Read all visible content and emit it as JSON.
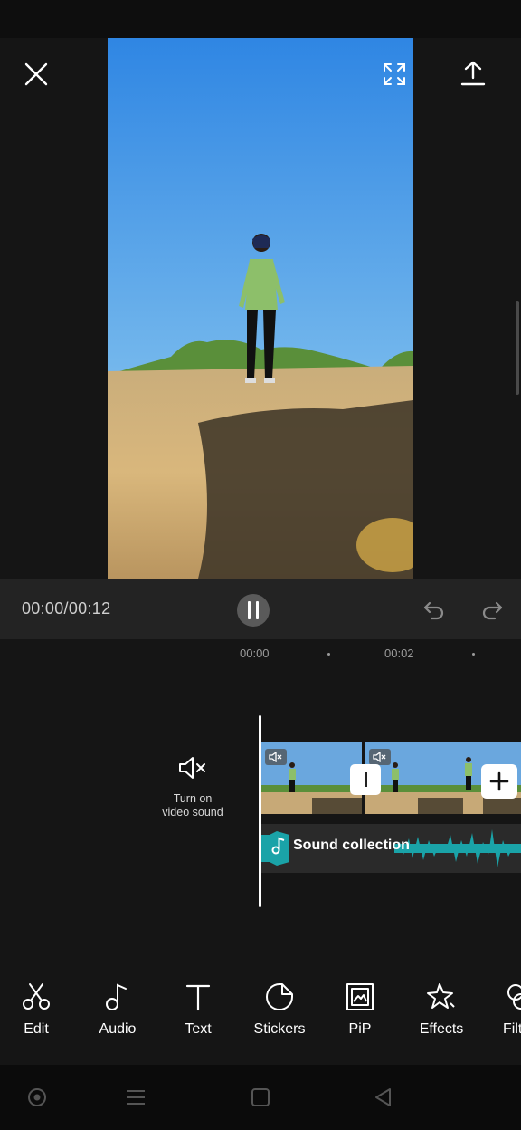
{
  "header": {
    "close_icon": "close-icon",
    "fullscreen_icon": "fullscreen-icon",
    "export_icon": "export-upload-icon"
  },
  "player": {
    "timecode": "00:00/00:12",
    "state": "playing",
    "pause_icon": "pause-icon",
    "undo_icon": "undo-icon",
    "redo_icon": "redo-icon"
  },
  "timeline": {
    "ruler": [
      "00:00",
      "00:02"
    ],
    "mute_control": {
      "icon": "speaker-muted-icon",
      "label_line1": "Turn on",
      "label_line2": "video sound"
    },
    "clips": [
      {
        "muted": true
      },
      {
        "muted": true
      }
    ],
    "add_clip_icon": "plus-icon",
    "audio_track": {
      "icon": "music-note-icon",
      "label": "Sound collection",
      "color": "#1aa3a8"
    }
  },
  "toolbar": {
    "tools": [
      {
        "label": "Edit",
        "icon": "scissors-icon"
      },
      {
        "label": "Audio",
        "icon": "music-note-icon"
      },
      {
        "label": "Text",
        "icon": "text-icon"
      },
      {
        "label": "Stickers",
        "icon": "sticker-icon"
      },
      {
        "label": "PiP",
        "icon": "pip-icon"
      },
      {
        "label": "Effects",
        "icon": "effects-star-icon"
      },
      {
        "label": "Filt",
        "icon": "filters-icon"
      }
    ]
  },
  "nav": {
    "buttons": [
      "assistant-icon",
      "menu-icon",
      "home-icon",
      "back-icon"
    ]
  },
  "colors": {
    "background": "#151515",
    "panel": "#232323",
    "accent_audio": "#1aa3a8"
  }
}
